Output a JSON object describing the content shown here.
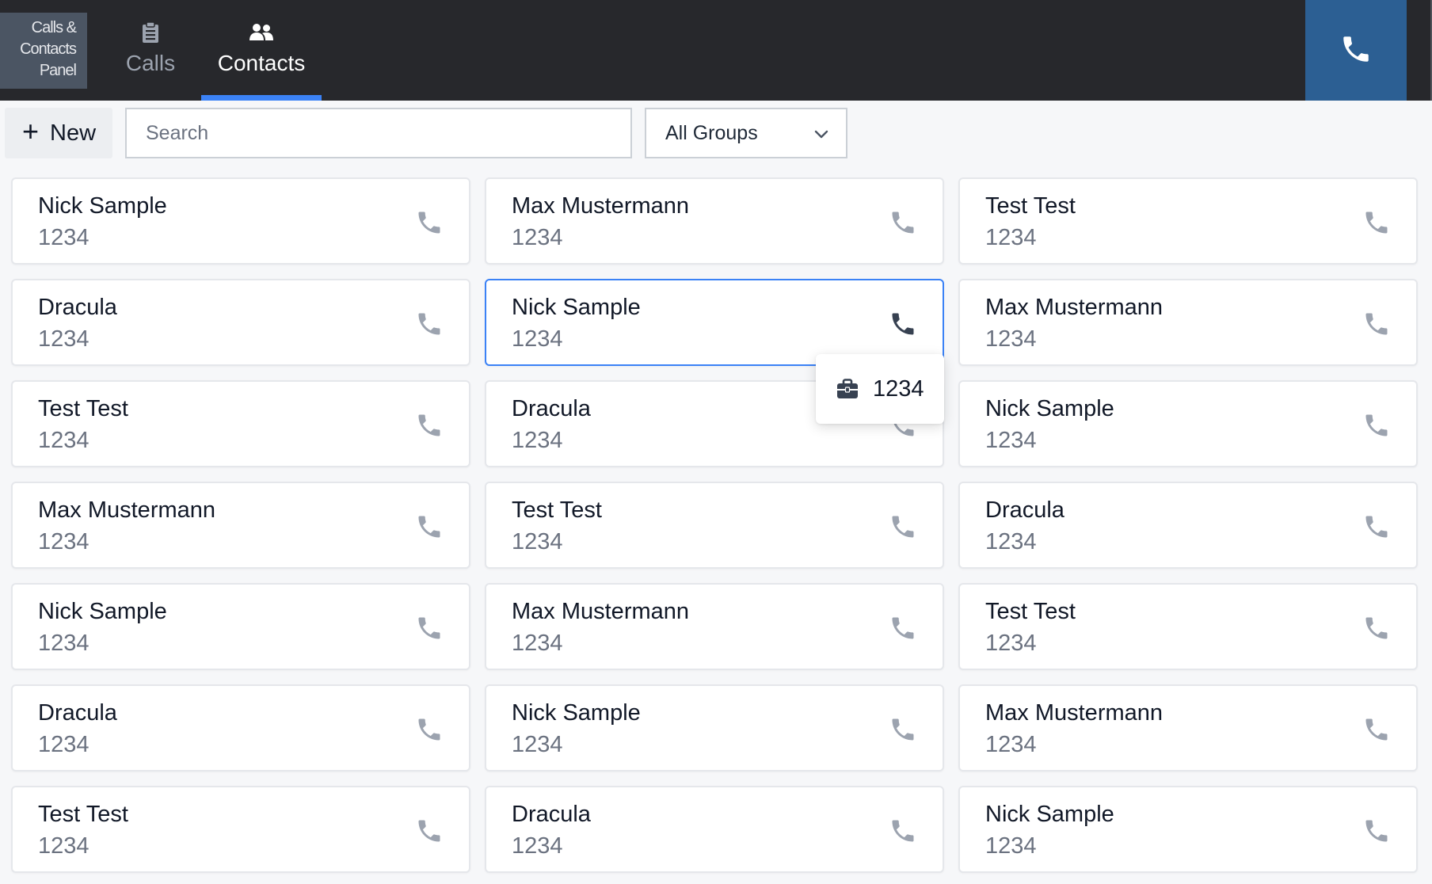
{
  "header": {
    "app_title": "Calls & Contacts Panel",
    "tabs": [
      {
        "label": "Calls",
        "icon": "clipboard-icon",
        "active": false
      },
      {
        "label": "Contacts",
        "icon": "users-icon",
        "active": true
      }
    ],
    "phone_button_icon": "phone-icon"
  },
  "toolbar": {
    "new_label": "New",
    "search_placeholder": "Search",
    "group_select_value": "All Groups"
  },
  "contacts": [
    {
      "name": "Nick Sample",
      "number": "1234"
    },
    {
      "name": "Max Mustermann",
      "number": "1234"
    },
    {
      "name": "Test Test",
      "number": "1234"
    },
    {
      "name": "Dracula",
      "number": "1234"
    },
    {
      "name": "Nick Sample",
      "number": "1234"
    },
    {
      "name": "Max Mustermann",
      "number": "1234"
    },
    {
      "name": "Test Test",
      "number": "1234"
    },
    {
      "name": "Dracula",
      "number": "1234"
    },
    {
      "name": "Nick Sample",
      "number": "1234"
    },
    {
      "name": "Max Mustermann",
      "number": "1234"
    },
    {
      "name": "Test Test",
      "number": "1234"
    },
    {
      "name": "Dracula",
      "number": "1234"
    },
    {
      "name": "Nick Sample",
      "number": "1234"
    },
    {
      "name": "Max Mustermann",
      "number": "1234"
    },
    {
      "name": "Test Test",
      "number": "1234"
    },
    {
      "name": "Dracula",
      "number": "1234"
    },
    {
      "name": "Nick Sample",
      "number": "1234"
    },
    {
      "name": "Max Mustermann",
      "number": "1234"
    },
    {
      "name": "Test Test",
      "number": "1234"
    },
    {
      "name": "Dracula",
      "number": "1234"
    },
    {
      "name": "Nick Sample",
      "number": "1234"
    }
  ],
  "popover": {
    "icon": "briefcase-icon",
    "number": "1234"
  },
  "colors": {
    "topbar": "#27282c",
    "accent": "#3b82f6",
    "phone_button": "#2c5f93"
  }
}
